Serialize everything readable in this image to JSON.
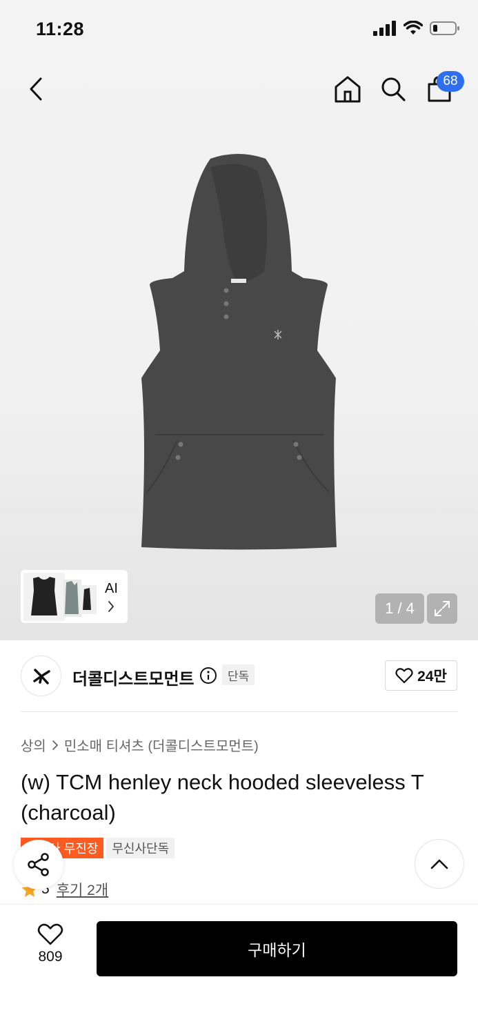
{
  "status": {
    "time": "11:28"
  },
  "header": {
    "cart_count": "68"
  },
  "gallery": {
    "ai_label": "AI",
    "pager": "1 / 4"
  },
  "brand": {
    "name": "더콜디스트모먼트",
    "badge": "단독",
    "like_count": "24만"
  },
  "breadcrumb": {
    "category": "상의",
    "subcategory": "민소매 티셔츠 (더콜디스트모먼트)"
  },
  "product": {
    "title": "(w) TCM henley neck hooded sleeveless T (charcoal)",
    "tags": [
      "무신사 무진장",
      "무신사단독"
    ],
    "rating": "5",
    "reviews": "후기 2개"
  },
  "bottom_bar": {
    "wish_count": "809",
    "buy_label": "구매하기"
  },
  "colors": {
    "accent_blue": "#2e6ff2",
    "tag_orange": "#ff5a1f",
    "star": "#f5a623",
    "product_charcoal": "#474847"
  },
  "icons": [
    "back-icon",
    "home-icon",
    "search-icon",
    "cart-icon",
    "chevron-right-icon",
    "expand-icon",
    "info-icon",
    "heart-icon",
    "star-icon",
    "share-icon",
    "chevron-up-icon",
    "signal-icon",
    "wifi-icon",
    "battery-icon"
  ]
}
